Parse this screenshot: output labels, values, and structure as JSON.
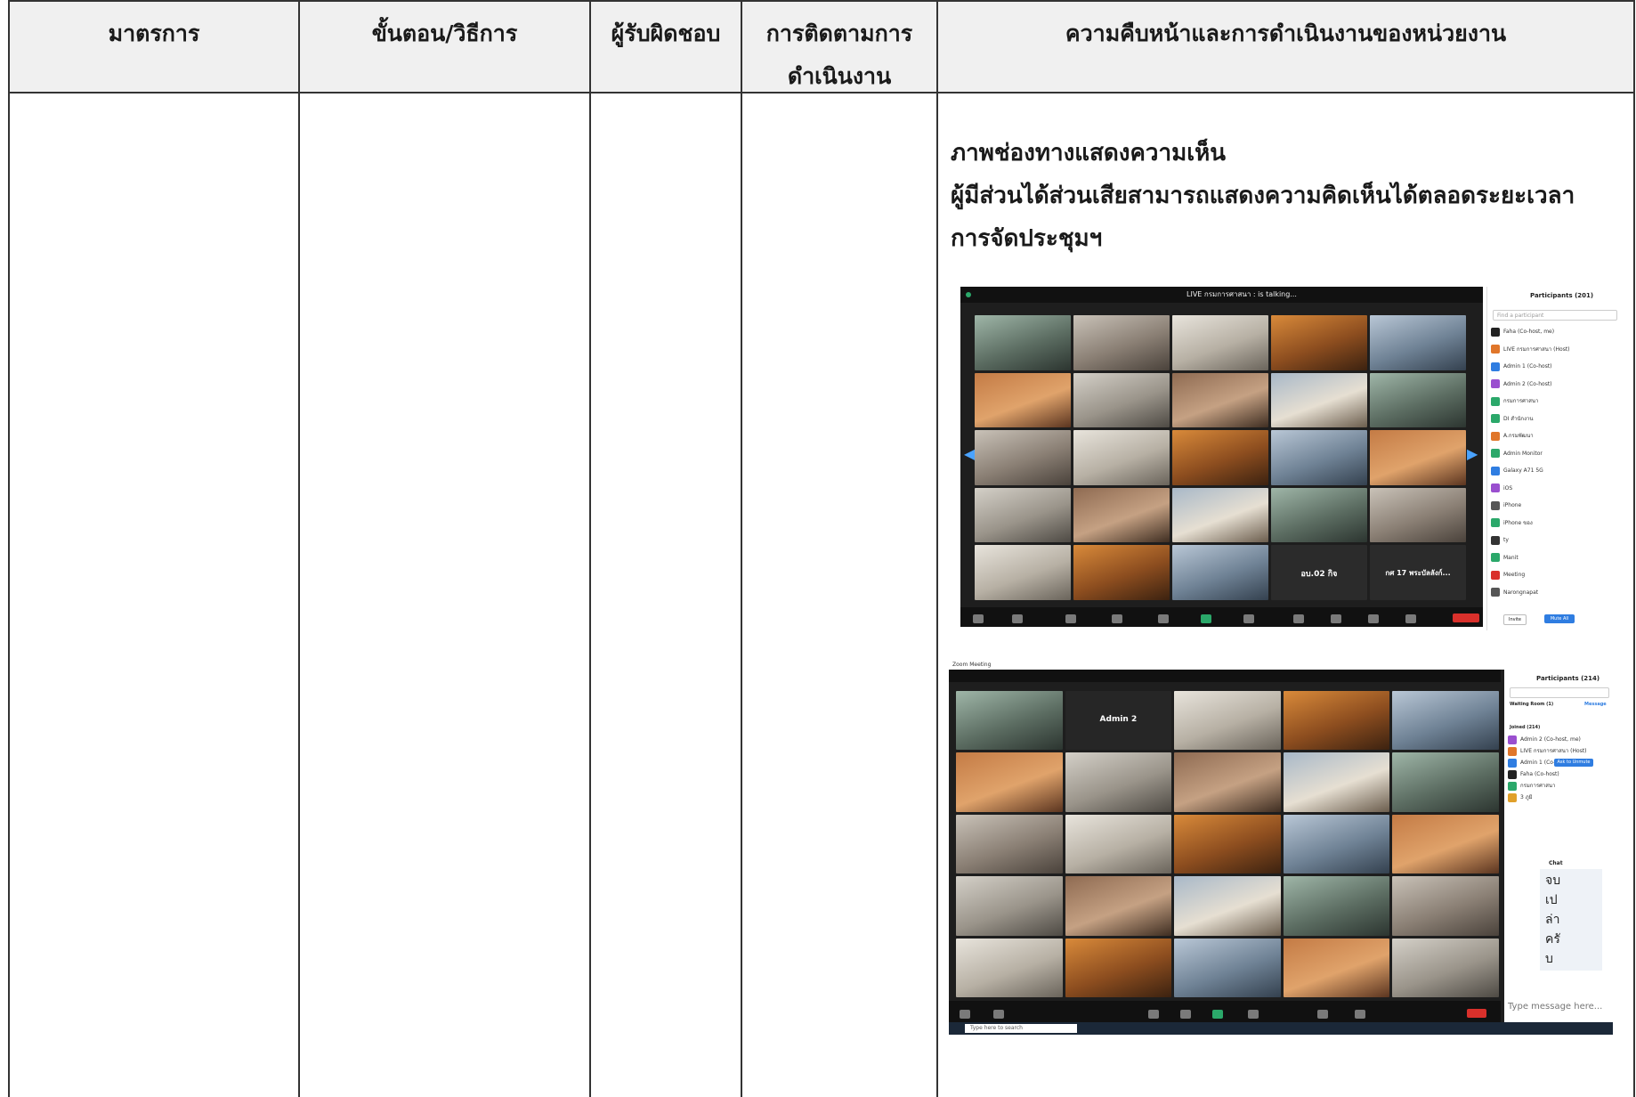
{
  "table": {
    "headers": [
      [
        "มาตรการ"
      ],
      [
        "ขั้นตอน/วิธีการ"
      ],
      [
        "ผู้รับผิดชอบ"
      ],
      [
        "การติดตามการ",
        "ดำเนินงาน"
      ],
      [
        "ความคืบหน้าและการดำเนินงานของหน่วยงาน"
      ]
    ]
  },
  "content": {
    "lines": [
      "ภาพช่องทางแสดงความเห็น",
      "ผู้มีส่วนได้ส่วนเสียสามารถแสดงความคิดเห็นได้ตลอดระยะเวลา",
      "การจัดประชุมฯ"
    ]
  },
  "screenshot1": {
    "talking": "LIVE กรมการศาสนา : is talking...",
    "panel_title": "Participants (201)",
    "search_placeholder": "Find a participant",
    "participants": [
      {
        "name": "Faha (Co-host, me)",
        "color": "#222222"
      },
      {
        "name": "LIVE กรมการศาสนา (Host)",
        "color": "#e0762a"
      },
      {
        "name": "Admin 1 (Co-host)",
        "color": "#2f7de1"
      },
      {
        "name": "Admin 2 (Co-host)",
        "color": "#9a4fcf"
      },
      {
        "name": "กรมการศาสนา",
        "color": "#2ba86a"
      },
      {
        "name": "DI สำนักงาน",
        "color": "#2ba86a"
      },
      {
        "name": "A.กรมพัฒนา",
        "color": "#e0762a"
      },
      {
        "name": "Admin Monitor",
        "color": "#2ba86a"
      },
      {
        "name": "Galaxy A71 5G",
        "color": "#2f7de1"
      },
      {
        "name": "iOS",
        "color": "#9a4fcf"
      },
      {
        "name": "iPhone",
        "color": "#555555"
      },
      {
        "name": "iPhone ของ",
        "color": "#2ba86a"
      },
      {
        "name": "ty",
        "color": "#333333"
      },
      {
        "name": "Manit",
        "color": "#2ba86a"
      },
      {
        "name": "Meeting",
        "color": "#d9302b"
      },
      {
        "name": "Narongnapat",
        "color": "#555555"
      }
    ],
    "invite_label": "Invite",
    "mute_all_label": "Mute All",
    "leave_label": "Leave",
    "tile_labels": [
      "อบ.02 กิจ",
      "กศ 17 พระบัลลังก์..."
    ]
  },
  "screenshot2": {
    "window_title": "Zoom Meeting",
    "admin_tile": "Admin 2",
    "panel_title": "Participants (214)",
    "waiting_room": "Waiting Room (1)",
    "message_label": "Message",
    "joined_label": "Joined (214)",
    "participants": [
      {
        "name": "Admin 2 (Co-host, me)",
        "color": "#9a4fcf"
      },
      {
        "name": "LIVE กรมการศาสนา (Host)",
        "color": "#e0762a"
      },
      {
        "name": "Admin 1 (Co-host)",
        "color": "#2f7de1"
      },
      {
        "name": "Faha (Co-host)",
        "color": "#222222"
      },
      {
        "name": "กรมการศาสนา",
        "color": "#2ba86a"
      },
      {
        "name": "3 ภูมิ",
        "color": "#e0a02a"
      }
    ],
    "ask_unmute": "Ask to Unmute",
    "chat_title": "Chat",
    "chat_message": [
      "จบ",
      "เป",
      "ล่า",
      "ครั",
      "บ"
    ],
    "chat_placeholder": "Type message here...",
    "taskbar_search": "Type here to search",
    "leave_label": "Leave"
  }
}
